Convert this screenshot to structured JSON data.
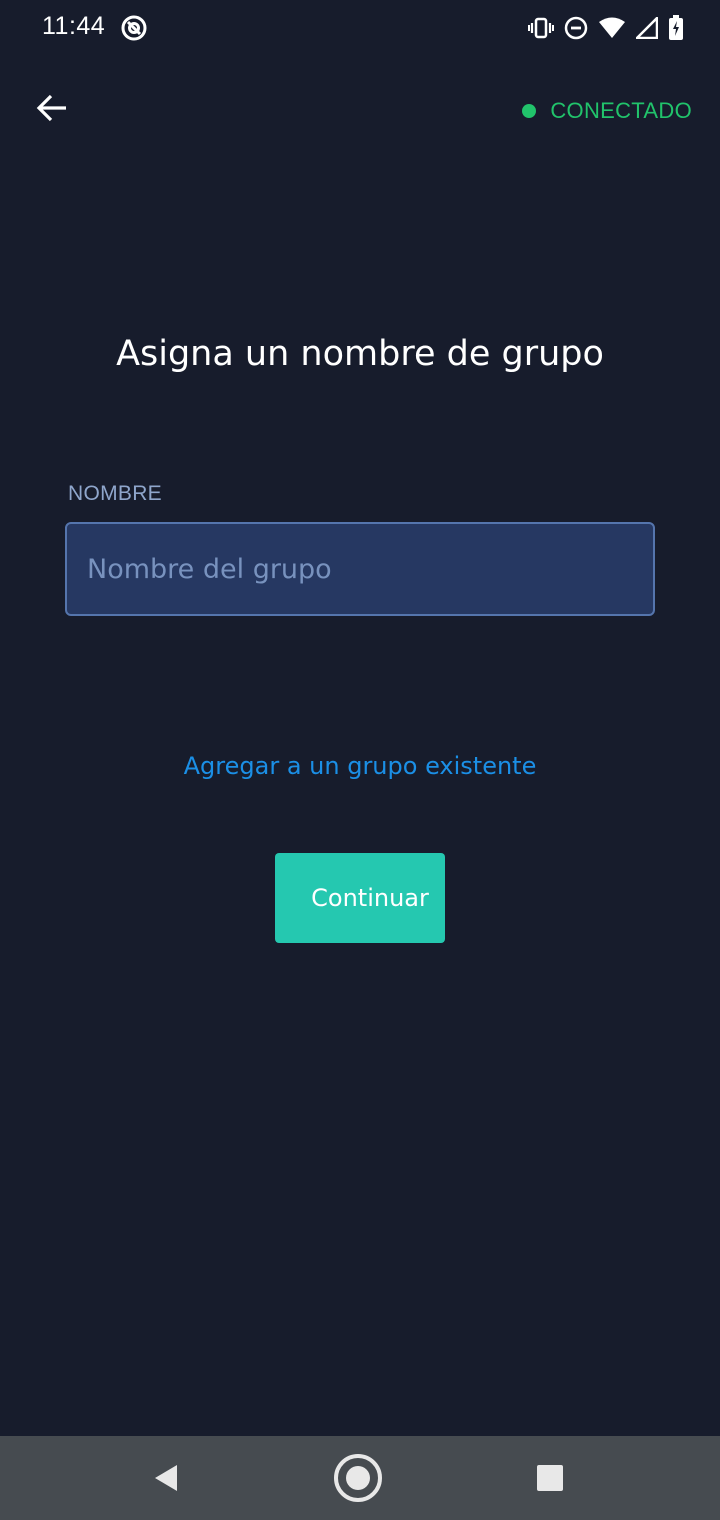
{
  "status_bar": {
    "time": "11:44",
    "icons": [
      "at-sign-icon",
      "vibrate-icon",
      "do-not-disturb-icon",
      "wifi-icon",
      "signal-icon",
      "battery-charging-icon"
    ]
  },
  "header": {
    "back_icon": "arrow-left-icon",
    "connection_label": "CONECTADO",
    "connection_color": "#21c36b"
  },
  "main": {
    "title": "Asigna un nombre de grupo",
    "field_label": "NOMBRE",
    "name_input": {
      "value": "",
      "placeholder": "Nombre del grupo"
    },
    "existing_group_link": "Agregar a un grupo existente",
    "continue_label": "Continuar"
  },
  "colors": {
    "background": "#171c2c",
    "accent": "#25c8b0",
    "link": "#1b8fe6",
    "input_bg": "#263862"
  },
  "nav_bar": {
    "icons": [
      "nav-back-icon",
      "nav-home-icon",
      "nav-recents-icon"
    ]
  }
}
